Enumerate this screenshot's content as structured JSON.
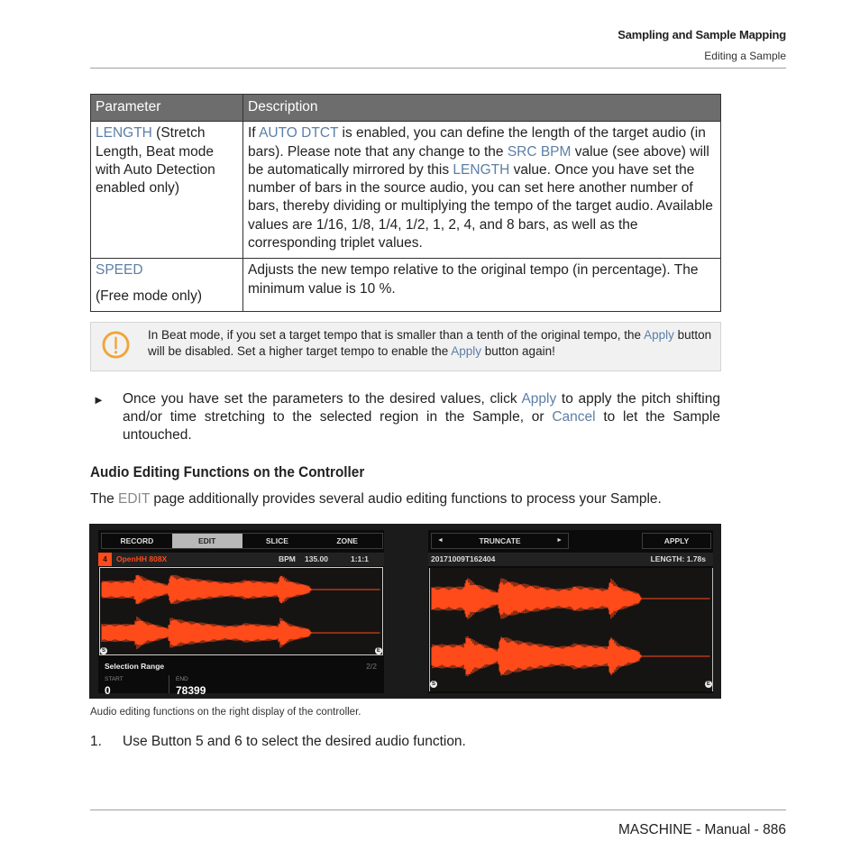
{
  "header": {
    "chapter": "Sampling and Sample Mapping",
    "section": "Editing a Sample"
  },
  "table": {
    "columns": [
      "Parameter",
      "Description"
    ],
    "rows": [
      {
        "param_keyword": "LENGTH",
        "param_rest": " (Stretch Length, Beat mode with Auto Detection enabled only)",
        "desc": {
          "p1": "If ",
          "k1": "AUTO DTCT",
          "p2": " is enabled, you can define the length of the target audio (in bars). Please note that any change to the ",
          "k2": "SRC BPM",
          "p3": " value (see above) will be automatically mirrored by this ",
          "k3": "LENGTH",
          "p4": " value. Once you have set the number of bars in the source audio, you can set here another number of bars, thereby dividing or multiplying the tempo of the target audio. Available values are 1/16, 1/8, 1/4, 1/2, 1, 2, 4, and 8 bars, as well as the corresponding triplet values."
        }
      },
      {
        "param_keyword": "SPEED",
        "param_sub": "(Free mode only)",
        "desc": "Adjusts the new tempo relative to the original tempo (in percentage). The minimum value is 10 %."
      }
    ]
  },
  "note": {
    "icon": "exclamation-circle-icon",
    "icon_color": "#f0a53a",
    "p1": "In Beat mode, if you set a target tempo that is smaller than a tenth of the original tempo, the ",
    "k1": "Apply",
    "p2": " button will be disabled. Set a higher target tempo to enable the ",
    "k2": "Apply",
    "p3": " button again!"
  },
  "bullet": {
    "marker": "►",
    "p1": "Once you have set the parameters to the desired values, click ",
    "k1": "Apply",
    "p2": " to apply the pitch shifting and/or time stretching to the selected region in the Sample, or ",
    "k2": "Cancel",
    "p3": " to let the Sample untouched."
  },
  "section": {
    "heading": "Audio Editing Functions on the Controller",
    "intro_p1": "The ",
    "intro_k1": "EDIT",
    "intro_p2": " page additionally provides several audio editing functions to process your Sample."
  },
  "controller": {
    "left_display": {
      "tabs": [
        "RECORD",
        "EDIT",
        "SLICE",
        "ZONE"
      ],
      "active_tab": "EDIT",
      "slot_number": "4",
      "sample_name": "OpenHH 808X",
      "bpm_label": "BPM",
      "bpm_value": "135.00",
      "position": "1:1:1",
      "start_marker": "S",
      "end_marker": "E",
      "selection_label": "Selection Range",
      "page_indicator": "2/2",
      "start_label": "START",
      "start_value": "0",
      "end_label": "END",
      "end_value": "78399"
    },
    "right_display": {
      "prev_arrow": "◄",
      "function_name": "TRUNCATE",
      "next_arrow": "►",
      "apply_label": "APPLY",
      "sample_name": "20171009T162404",
      "length_text": "LENGTH: 1.78s",
      "start_marker": "S",
      "end_marker": "E"
    },
    "waveform_color": "#ff4a1a"
  },
  "caption": "Audio editing functions on the right display of the controller.",
  "step": {
    "number": "1.",
    "text": "Use Button 5 and 6 to select the desired audio function."
  },
  "footer": "MASCHINE - Manual - 886"
}
